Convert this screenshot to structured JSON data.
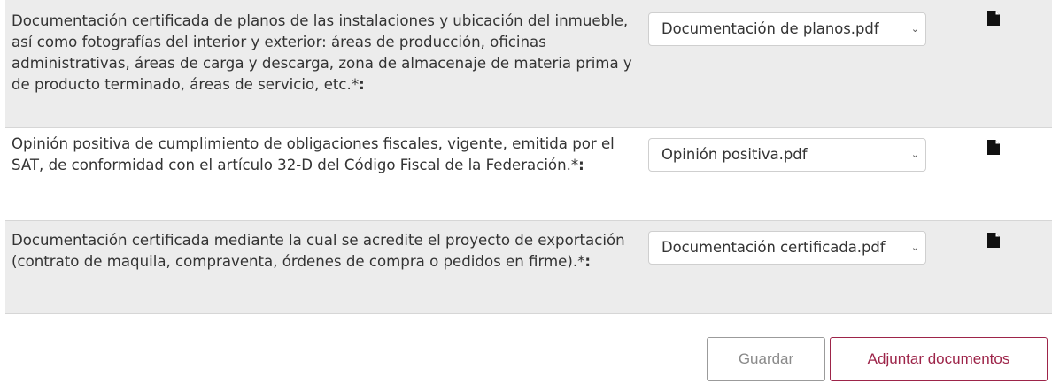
{
  "documents": [
    {
      "label": "Documentación certificada de planos de las instalaciones y ubicación del inmueble, así como fotografías del interior y exterior: áreas de producción, oficinas administrativas, áreas de carga y descarga, zona de almacenaje de materia prima y de producto terminado, áreas de servicio, etc.",
      "required_mark": "*",
      "suffix": ":",
      "selected_file": "Documentación de planos.pdf",
      "icon": "file-icon"
    },
    {
      "label": "Opinión positiva de cumplimiento de obligaciones fiscales, vigente, emitida por el SAT, de conformidad con el artículo 32-D del Código Fiscal de la Federación.",
      "required_mark": "*",
      "suffix": ":",
      "selected_file": "Opinión positiva.pdf",
      "icon": "file-icon"
    },
    {
      "label": "Documentación certificada mediante la cual se acredite el proyecto de exportación (contrato de maquila, compraventa, órdenes de compra o pedidos en firme).",
      "required_mark": "*",
      "suffix": ":",
      "selected_file": "Documentación certificada.pdf",
      "icon": "file-icon"
    }
  ],
  "actions": {
    "save_label": "Guardar",
    "attach_label": "Adjuntar documentos"
  },
  "colors": {
    "row_shaded": "#ececec",
    "accent": "#9d2449",
    "border": "#d6d6d6"
  }
}
